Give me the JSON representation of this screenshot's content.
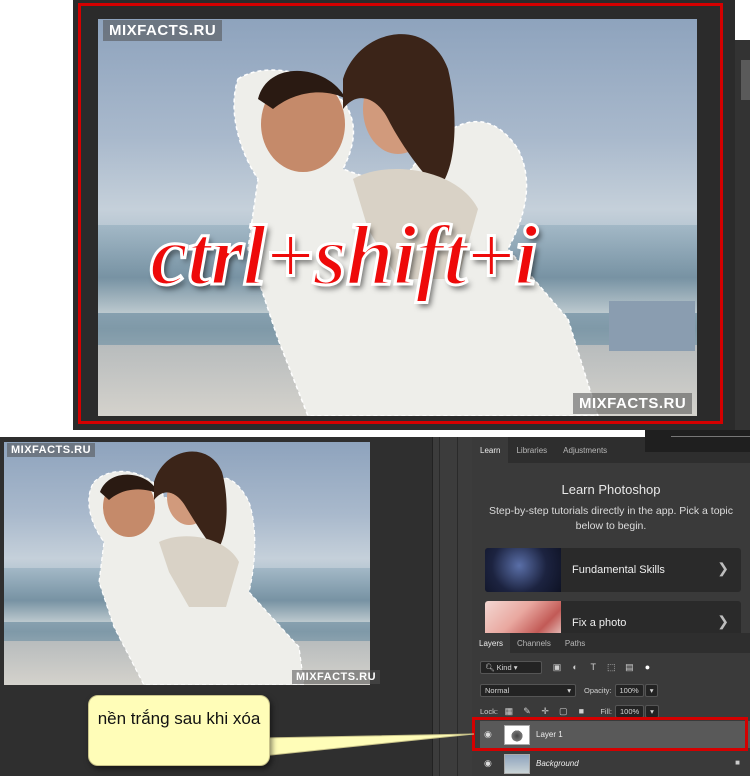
{
  "top_image": {
    "watermark_top": "MIXFACTS.RU",
    "watermark_bottom": "MIXFACTS.RU",
    "overlay_text": "ctrl+shift+i"
  },
  "bottom_image": {
    "watermark_top": "MIXFACTS.RU",
    "watermark_bottom": "MIXFACTS.RU"
  },
  "learn_panel": {
    "tabs": [
      "Learn",
      "Libraries",
      "Adjustments"
    ],
    "title": "Learn Photoshop",
    "description": "Step-by-step tutorials directly in the app. Pick a topic below to begin.",
    "cards": [
      {
        "label": "Fundamental Skills"
      },
      {
        "label": "Fix a photo"
      }
    ]
  },
  "layers_panel": {
    "tabs": [
      "Layers",
      "Channels",
      "Paths"
    ],
    "kind_label": "Kind",
    "blend_mode": "Normal",
    "opacity_label": "Opacity:",
    "opacity_value": "100%",
    "lock_label": "Lock:",
    "fill_label": "Fill:",
    "fill_value": "100%",
    "layers": [
      {
        "name": "Layer 1"
      },
      {
        "name": "Background"
      }
    ]
  },
  "callout": {
    "text": "nền trắng sau khi xóa"
  },
  "colors": {
    "highlight_red": "#d40000",
    "overlay_text_red": "#ee0a0a",
    "callout_yellow": "#fffdb8",
    "panel_dark": "#3a3a3a"
  }
}
